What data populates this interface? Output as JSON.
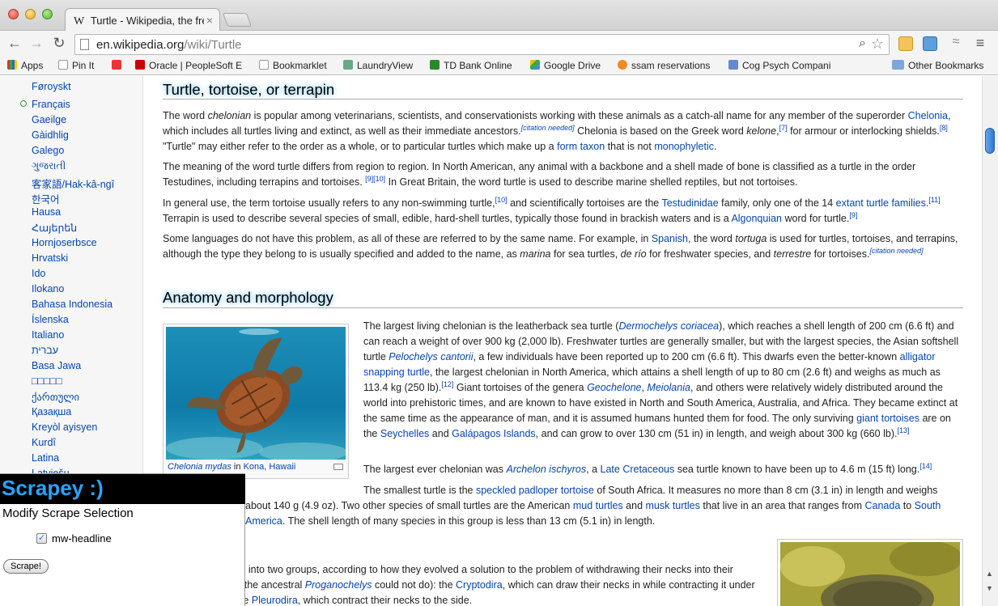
{
  "browser": {
    "tab_title": "Turtle - Wikipedia, the free",
    "tab_favicon": "W",
    "url_host": "en.wikipedia.org",
    "url_path": "/wiki/Turtle"
  },
  "bookmarks": [
    {
      "label": "Apps",
      "icon": "apps-grid-icon"
    },
    {
      "label": "Pin It",
      "icon": "page-icon"
    },
    {
      "label": "",
      "icon": "bookmarklet-icon"
    },
    {
      "label": "Oracle | PeopleSoft E",
      "icon": "oracle-icon"
    },
    {
      "label": "Bookmarklet",
      "icon": "page-icon"
    },
    {
      "label": "LaundryView",
      "icon": "laundry-icon"
    },
    {
      "label": "TD Bank Online",
      "icon": "td-icon"
    },
    {
      "label": "Google Drive",
      "icon": "drive-icon"
    },
    {
      "label": "ssam reservations",
      "icon": "orange-icon"
    },
    {
      "label": "Cog Psych Compani",
      "icon": "cog-icon"
    },
    {
      "label": "Other Bookmarks",
      "icon": "folder-icon"
    }
  ],
  "sidebar": {
    "languages": [
      "Føroyskt",
      "Français",
      "Gaeilge",
      "Gàidhlig",
      "Galego",
      "ગુજરાતી",
      "客家語/Hak-kâ-ngî",
      "한국어",
      "Hausa",
      "Հայերեն",
      "Hornjoserbsce",
      "Hrvatski",
      "Ido",
      "Ilokano",
      "Bahasa Indonesia",
      "Íslenska",
      "Italiano",
      "עברית",
      "Basa Jawa",
      "□□□□□",
      "ქართული",
      "Қазақша",
      "Kreyòl ayisyen",
      "Kurdî",
      "Latina",
      "Latviešu"
    ]
  },
  "article": {
    "h_turtle": "Turtle, tortoise, or terrapin",
    "h_anatomy": "Anatomy and morphology",
    "caption_species": "Chelonia mydas",
    "caption_in": " in ",
    "caption_place": "Kona, Hawaii"
  },
  "scrapey": {
    "title": "Scrapey :)",
    "subtitle": "Modify Scrape Selection",
    "checkbox_label": "mw-headline",
    "checkbox_checked": "✓",
    "button_label": "Scrape!"
  }
}
